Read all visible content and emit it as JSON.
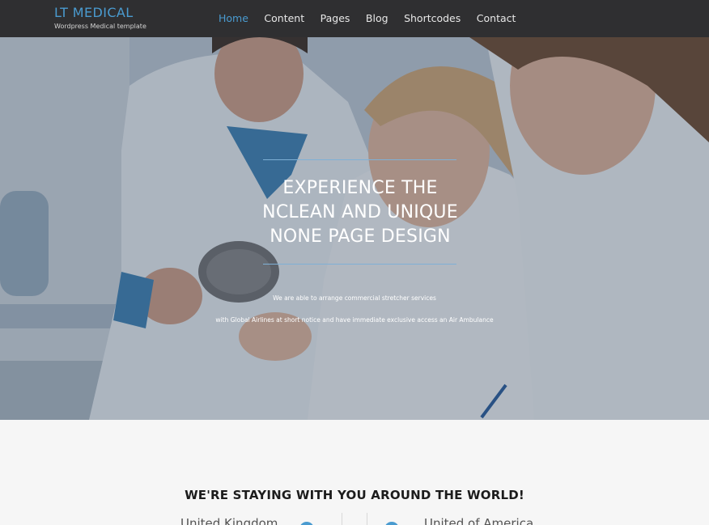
{
  "header": {
    "logo_title": "LT MEDICAL",
    "logo_subtitle": "Wordpress Medical template",
    "nav": [
      {
        "label": "Home",
        "active": true
      },
      {
        "label": "Content",
        "active": false
      },
      {
        "label": "Pages",
        "active": false
      },
      {
        "label": "Blog",
        "active": false
      },
      {
        "label": "Shortcodes",
        "active": false
      },
      {
        "label": "Contact",
        "active": false
      }
    ]
  },
  "hero": {
    "headline": [
      "EXPERIENCE THE",
      "NCLEAN AND UNIQUE",
      "NONE PAGE DESIGN"
    ],
    "sub_line_1": "We are able to arrange commercial stretcher services",
    "sub_line_2": "with Global Airlines at short notice and have immediate exclusive access an Air Ambulance"
  },
  "section": {
    "title": "WE'RE STAYING WITH YOU AROUND THE WORLD!",
    "locations": [
      "United Kingdom",
      "United of America"
    ]
  },
  "colors": {
    "accent": "#4a9bd0",
    "header_bg": "#2f2f31",
    "section_bg": "#f6f6f6"
  }
}
